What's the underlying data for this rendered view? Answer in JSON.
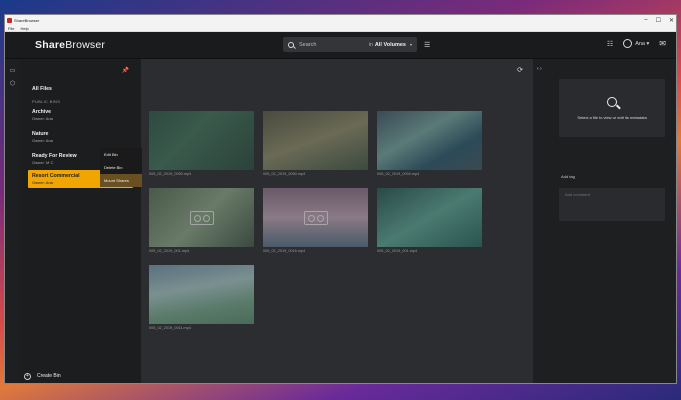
{
  "window": {
    "title": "ShareBrowser",
    "minimize": "–",
    "maximize": "☐",
    "close": "✕"
  },
  "menubar": {
    "items": [
      "File",
      "Help"
    ]
  },
  "header": {
    "brand_part1": "Share",
    "brand_part2": "Browser",
    "search_placeholder": "Search",
    "search_in": "in",
    "search_scope": "All Volumes",
    "user_name": "Ana"
  },
  "sidebar": {
    "all_files": "All Files",
    "section_public_bins": "PUBLIC BINS",
    "bins": [
      {
        "name": "Archive",
        "owner": "Owner: Ana"
      },
      {
        "name": "Nature",
        "owner": "Owner: Ana"
      },
      {
        "name": "Ready For Review",
        "owner": "Owner: M C"
      },
      {
        "name": "Resort Commercial",
        "owner": "Owner: Ana"
      }
    ],
    "create_bin": "Create Bin"
  },
  "context_menu": {
    "items": [
      "Edit Bin",
      "Delete Bin",
      "Mount Shares"
    ]
  },
  "files": [
    {
      "name": "005_02_2019_0050.mp4",
      "thumb": "t1",
      "placeholder": false
    },
    {
      "name": "005_02_2019_0050.mp4",
      "thumb": "t2",
      "placeholder": false
    },
    {
      "name": "005_02_2019_0004.mp4",
      "thumb": "t3",
      "placeholder": false
    },
    {
      "name": "005_02_2019_001.mp4",
      "thumb": "t4",
      "placeholder": true
    },
    {
      "name": "005_02_2019_0016.mp4",
      "thumb": "t5",
      "placeholder": true
    },
    {
      "name": "005_02_2019_001.mp4",
      "thumb": "t6",
      "placeholder": false
    },
    {
      "name": "005_02_2019_0011.mp4",
      "thumb": "t7",
      "placeholder": false
    }
  ],
  "metadata": {
    "empty_message": "Select a file to view or edit its metadata",
    "add_tag": "Add tag",
    "comment_placeholder": "Add comment"
  },
  "colors": {
    "accent": "#f0a500"
  }
}
